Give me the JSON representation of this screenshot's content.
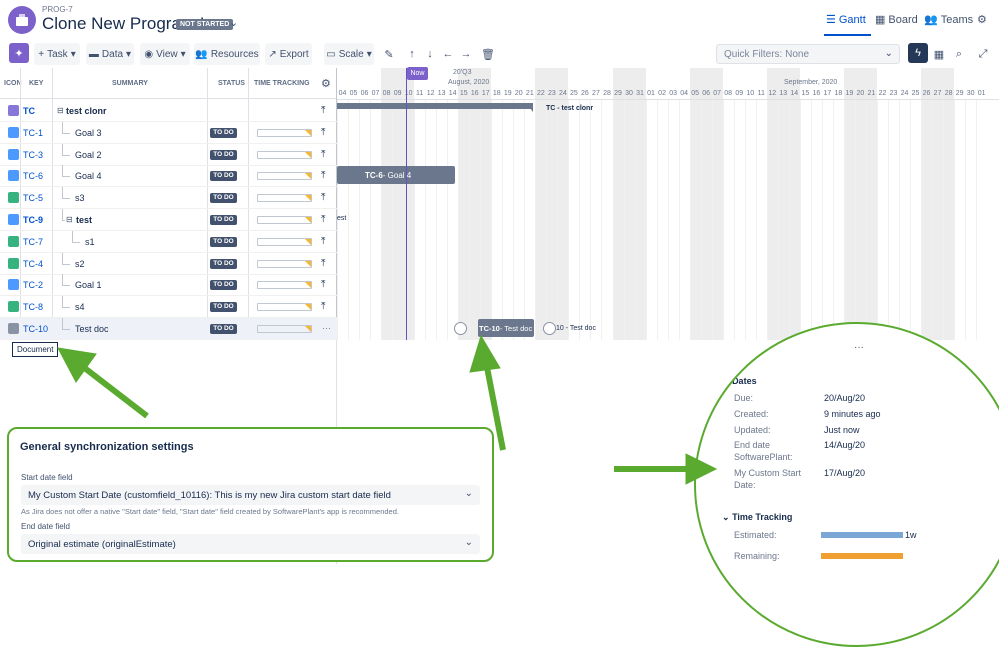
{
  "header": {
    "breadcrumb": "PROG-7",
    "title": "Clone New Program I",
    "status_badge": "NOT STARTED",
    "nav": {
      "gantt": "Gantt",
      "board": "Board",
      "teams": "Teams"
    }
  },
  "toolbar": {
    "task": "Task",
    "data": "Data",
    "view": "View",
    "resources": "Resources",
    "export": "Export",
    "scale": "Scale",
    "quick_filters": "Quick Filters: None"
  },
  "grid": {
    "columns": {
      "icon": "ICON",
      "key": "KEY",
      "summary": "SUMMARY",
      "status": "STATUS",
      "time_tracking": "TIME TRACKING (I"
    },
    "rows": [
      {
        "key": "TC",
        "summary": "test clonr",
        "icon": "epic-icon",
        "status": ""
      },
      {
        "key": "TC-1",
        "summary": "Goal 3",
        "icon": "checkbox-icon",
        "status": "TO DO"
      },
      {
        "key": "TC-3",
        "summary": "Goal 2",
        "icon": "checkbox-icon",
        "status": "TO DO"
      },
      {
        "key": "TC-6",
        "summary": "Goal 4",
        "icon": "checkbox-icon",
        "status": "TO DO"
      },
      {
        "key": "TC-5",
        "summary": "s3",
        "icon": "bookmark-icon",
        "status": "TO DO"
      },
      {
        "key": "TC-9",
        "summary": "test",
        "icon": "checkbox-icon",
        "status": "TO DO"
      },
      {
        "key": "TC-7",
        "summary": "s1",
        "icon": "bookmark-icon",
        "status": "TO DO"
      },
      {
        "key": "TC-4",
        "summary": "s2",
        "icon": "bookmark-icon",
        "status": "TO DO"
      },
      {
        "key": "TC-2",
        "summary": "Goal 1",
        "icon": "checkbox-icon",
        "status": "TO DO"
      },
      {
        "key": "TC-8",
        "summary": "s4",
        "icon": "bookmark-icon",
        "status": "TO DO"
      },
      {
        "key": "TC-10",
        "summary": "Test doc",
        "icon": "document-icon",
        "status": "TO DO"
      }
    ],
    "tooltip": "Document"
  },
  "timeline": {
    "quarter": "20'Q3",
    "month_aug": "August, 2020",
    "month_sep": "September, 2020",
    "now": "Now",
    "days": [
      "04",
      "05",
      "06",
      "07",
      "08",
      "09",
      "10",
      "11",
      "12",
      "13",
      "14",
      "15",
      "16",
      "17",
      "18",
      "19",
      "20",
      "21",
      "22",
      "23",
      "24",
      "25",
      "26",
      "27",
      "28",
      "29",
      "30",
      "31",
      "01",
      "02",
      "03",
      "04",
      "05",
      "06",
      "07",
      "08",
      "09",
      "10",
      "11",
      "12",
      "13",
      "14",
      "15",
      "16",
      "17",
      "18",
      "19",
      "20",
      "21",
      "22",
      "23",
      "24",
      "25",
      "26",
      "27",
      "28",
      "29",
      "30",
      "01"
    ],
    "bar_tc": "TC - test clonr",
    "bar_tc6_key": "TC-6",
    "bar_tc6_text": " - Goal 4",
    "bar_tc9_text": "est",
    "bar_tc10_key": "TC-10",
    "bar_tc10_text": " - Test doc",
    "tc10_label": "10 - Test doc"
  },
  "sync_settings": {
    "title": "General synchronization settings",
    "start_label": "Start date field",
    "start_value": "My Custom Start Date (customfield_10116): This is my new Jira custom start date field",
    "note": "As Jira does not offer a native \"Start date\" field, \"Start date\" field created by SoftwarePlant's app is recommended.",
    "end_label": "End date field",
    "end_value": "Original estimate (originalEstimate)"
  },
  "details": {
    "more": "···",
    "dates_title": "Dates",
    "due_label": "Due:",
    "due_value": "20/Aug/20",
    "created_label": "Created:",
    "created_value": "9 minutes ago",
    "updated_label": "Updated:",
    "updated_value": "Just now",
    "end_label_1": "End date",
    "end_label_2": "SoftwarePlant:",
    "end_value": "14/Aug/20",
    "custom_label_1": "My Custom Start",
    "custom_label_2": "Date:",
    "custom_value": "17/Aug/20",
    "tt_title": "Time Tracking",
    "estimated_label": "Estimated:",
    "estimated_value": "1w",
    "remaining_label": "Remaining:"
  },
  "colors": {
    "accent": "#0052cc",
    "purple": "#7b61c9",
    "annotation_green": "#5aaa30",
    "bar_gray": "#6b778c"
  }
}
